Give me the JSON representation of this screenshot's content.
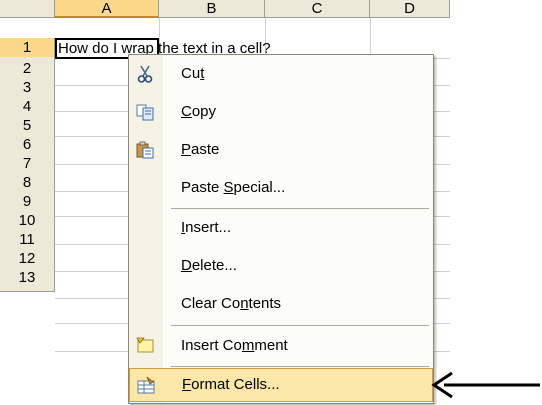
{
  "spreadsheet": {
    "columns": [
      "A",
      "B",
      "C",
      "D"
    ],
    "rows": [
      "1",
      "2",
      "3",
      "4",
      "5",
      "6",
      "7",
      "8",
      "9",
      "10",
      "11",
      "12",
      "13"
    ],
    "active_cell_text": "How do I wrap the text in a cell?"
  },
  "context_menu": {
    "items": [
      {
        "pre": "Cu",
        "key": "t",
        "post": "",
        "icon": "scissors-icon"
      },
      {
        "pre": "",
        "key": "C",
        "post": "opy",
        "icon": "copy-icon"
      },
      {
        "pre": "",
        "key": "P",
        "post": "aste",
        "icon": "paste-icon"
      },
      {
        "pre": "Paste ",
        "key": "S",
        "post": "pecial...",
        "icon": ""
      },
      {
        "pre": "",
        "key": "I",
        "post": "nsert...",
        "icon": ""
      },
      {
        "pre": "",
        "key": "D",
        "post": "elete...",
        "icon": ""
      },
      {
        "pre": "Clear Co",
        "key": "n",
        "post": "tents",
        "icon": ""
      },
      {
        "pre": "Insert Co",
        "key": "m",
        "post": "ment",
        "icon": "comment-icon"
      },
      {
        "pre": "",
        "key": "F",
        "post": "ormat Cells...",
        "icon": "format-cells-icon",
        "highlighted": true
      }
    ]
  },
  "colors": {
    "header_bg": "#ece9d8",
    "selected_header": "#fbd88a",
    "menu_highlight": "#fbe7a8",
    "menu_highlight_border": "#d19a3a"
  }
}
